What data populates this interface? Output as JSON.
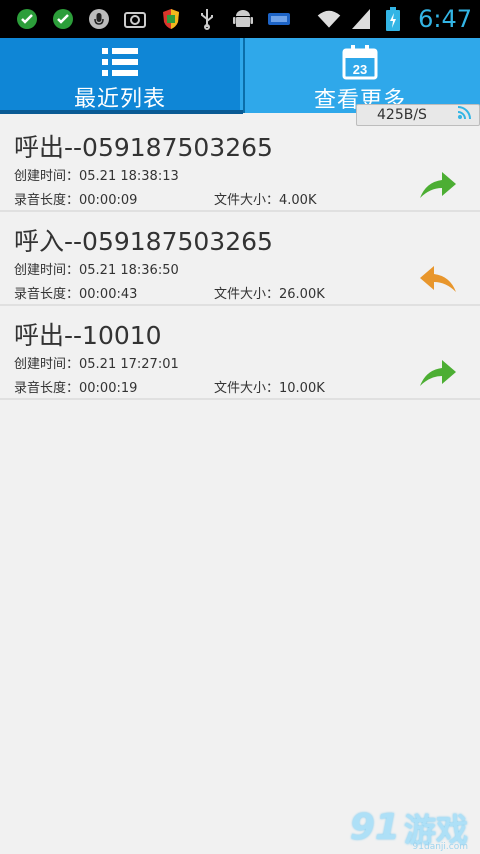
{
  "status_bar": {
    "time": "6:47",
    "icons_left": [
      "check-circle-icon",
      "check-circle-icon",
      "microphone-icon",
      "camera-icon",
      "shield-icon",
      "usb-icon",
      "android-icon",
      "battery-bar-icon"
    ],
    "icons_right": [
      "wifi-icon",
      "signal-icon",
      "battery-icon"
    ]
  },
  "tabs": [
    {
      "label": "最近列表",
      "icon": "list-icon",
      "active": true
    },
    {
      "label": "查看更多",
      "icon": "calendar-icon",
      "calendar_day": "23",
      "active": false
    }
  ],
  "speed_badge": {
    "text": "425B/S"
  },
  "records": [
    {
      "title": "呼出--059187503265",
      "created": "创建时间：05.21 18:38:13",
      "duration": "录音长度：00:00:09",
      "size": "文件大小：4.00K",
      "direction": "outgoing"
    },
    {
      "title": "呼入--059187503265",
      "created": "创建时间：05.21 18:36:50",
      "duration": "录音长度：00:00:43",
      "size": "文件大小：26.00K",
      "direction": "incoming"
    },
    {
      "title": "呼出--10010",
      "created": "创建时间：05.21 17:27:01",
      "duration": "录音长度：00:00:19",
      "size": "文件大小：10.00K",
      "direction": "outgoing"
    }
  ],
  "colors": {
    "accent": "#1b8fd8",
    "outgoing_arrow": "#4cae33",
    "incoming_arrow": "#e8962c",
    "status_time": "#33b5e5"
  },
  "watermark": {
    "brand": "91",
    "text": "游戏",
    "url": "91danji.com"
  }
}
